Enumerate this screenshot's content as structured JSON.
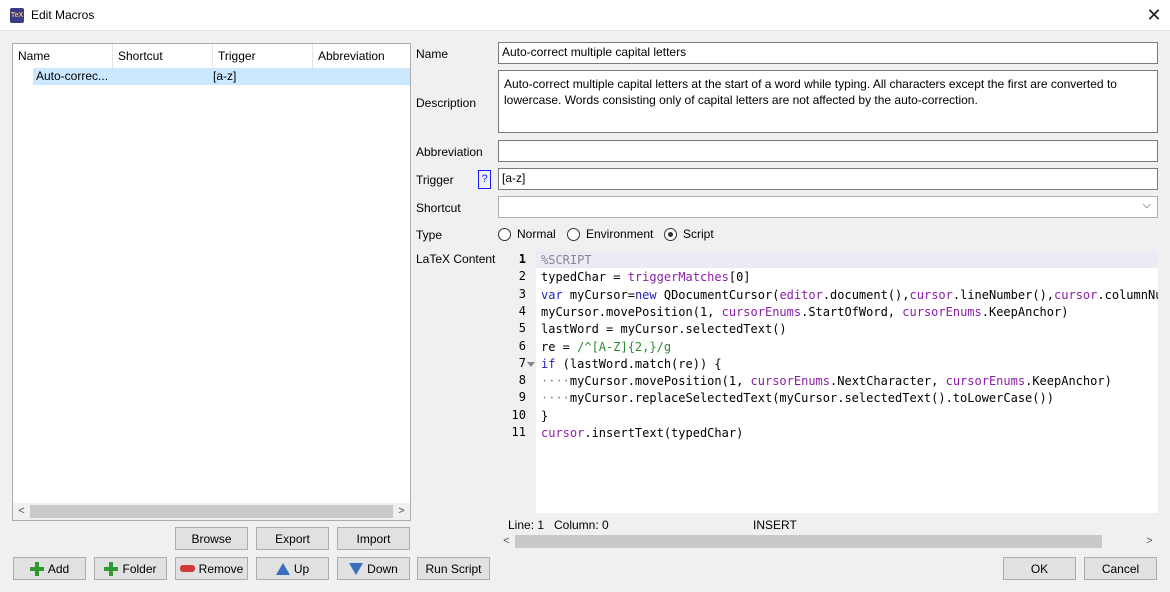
{
  "window": {
    "title": "Edit Macros",
    "app_icon_text": "TeX"
  },
  "tree": {
    "columns": [
      "Name",
      "Shortcut",
      "Trigger",
      "Abbreviation"
    ],
    "rows": [
      {
        "name": "Auto-correc...",
        "shortcut": "",
        "trigger": "[a-z]",
        "abbreviation": ""
      }
    ]
  },
  "buttons": {
    "browse": "Browse",
    "export": "Export",
    "import": "Import",
    "add": "Add",
    "folder": "Folder",
    "remove": "Remove",
    "up": "Up",
    "down": "Down",
    "run_script": "Run Script",
    "ok": "OK",
    "cancel": "Cancel"
  },
  "form": {
    "name_label": "Name",
    "name_value": "Auto-correct multiple capital letters",
    "description_label": "Description",
    "description_value": "Auto-correct multiple capital letters at the start of a word while typing. All characters except the first are converted to lowercase. Words consisting only of capital letters are not affected by the auto-correction.",
    "abbreviation_label": "Abbreviation",
    "abbreviation_value": "",
    "trigger_label": "Trigger",
    "trigger_help": "?",
    "trigger_value": "[a-z]",
    "shortcut_label": "Shortcut",
    "shortcut_value": "",
    "type_label": "Type",
    "type_options": [
      "Normal",
      "Environment",
      "Script"
    ],
    "type_selected": "Script",
    "latex_label": "LaTeX Content"
  },
  "editor": {
    "line_numbers": [
      "1",
      "2",
      "3",
      "4",
      "5",
      "6",
      "7",
      "8",
      "9",
      "10",
      "11"
    ],
    "lines": [
      [
        {
          "t": "%SCRIPT",
          "c": "grey"
        }
      ],
      [
        {
          "t": "typedChar = ",
          "c": "default"
        },
        {
          "t": "triggerMatches",
          "c": "purple"
        },
        {
          "t": "[0]",
          "c": "default"
        }
      ],
      [
        {
          "t": "var",
          "c": "blue"
        },
        {
          "t": " myCursor=",
          "c": "default"
        },
        {
          "t": "new",
          "c": "blue"
        },
        {
          "t": " QDocumentCursor(",
          "c": "default"
        },
        {
          "t": "editor",
          "c": "purple"
        },
        {
          "t": ".document(),",
          "c": "default"
        },
        {
          "t": "cursor",
          "c": "purple"
        },
        {
          "t": ".lineNumber(),",
          "c": "default"
        },
        {
          "t": "cursor",
          "c": "purple"
        },
        {
          "t": ".columnNumb",
          "c": "default"
        }
      ],
      [
        {
          "t": "myCursor.movePosition(1, ",
          "c": "default"
        },
        {
          "t": "cursorEnums",
          "c": "purple"
        },
        {
          "t": ".StartOfWord, ",
          "c": "default"
        },
        {
          "t": "cursorEnums",
          "c": "purple"
        },
        {
          "t": ".KeepAnchor)",
          "c": "default"
        }
      ],
      [
        {
          "t": "lastWord = myCursor.selectedText()",
          "c": "default"
        }
      ],
      [
        {
          "t": "re = ",
          "c": "default"
        },
        {
          "t": "/^[A-Z]{2,}/g",
          "c": "green"
        }
      ],
      [
        {
          "t": "if",
          "c": "blue"
        },
        {
          "t": " (lastWord.match(re)) {",
          "c": "default"
        }
      ],
      [
        {
          "t": "····",
          "c": "grey"
        },
        {
          "t": "myCursor.movePosition(1, ",
          "c": "default"
        },
        {
          "t": "cursorEnums",
          "c": "purple"
        },
        {
          "t": ".NextCharacter, ",
          "c": "default"
        },
        {
          "t": "cursorEnums",
          "c": "purple"
        },
        {
          "t": ".KeepAnchor)",
          "c": "default"
        }
      ],
      [
        {
          "t": "····",
          "c": "grey"
        },
        {
          "t": "myCursor.replaceSelectedText(myCursor.selectedText().toLowerCase())",
          "c": "default"
        }
      ],
      [
        {
          "t": "}",
          "c": "default"
        }
      ],
      [
        {
          "t": "cursor",
          "c": "purple"
        },
        {
          "t": ".insertText(typedChar)",
          "c": "default"
        }
      ]
    ],
    "status_line": "Line: 1",
    "status_column": "Column: 0",
    "status_mode": "INSERT"
  },
  "colors": {
    "selection": "#cce8ff",
    "keyword": "#1f1fb8",
    "object": "#8b1ea8",
    "regex": "#2e8b2e",
    "comment": "#888888"
  }
}
